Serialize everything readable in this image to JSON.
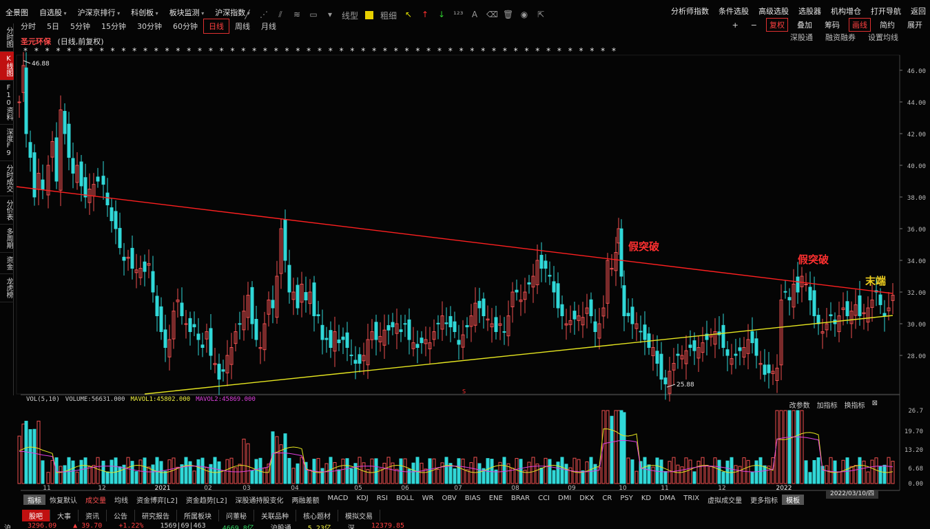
{
  "menu": [
    {
      "label": "全景图",
      "caret": false
    },
    {
      "label": "自选股",
      "caret": true
    },
    {
      "label": "沪深京排行",
      "caret": true
    },
    {
      "label": "科创板",
      "caret": true
    },
    {
      "label": "板块监测",
      "caret": true
    },
    {
      "label": "沪深指数",
      "caret": true
    }
  ],
  "periods": [
    {
      "label": "分时",
      "active": false
    },
    {
      "label": "5日",
      "active": false
    },
    {
      "label": "5分钟",
      "active": false
    },
    {
      "label": "15分钟",
      "active": false
    },
    {
      "label": "30分钟",
      "active": false
    },
    {
      "label": "60分钟",
      "active": false
    },
    {
      "label": "日线",
      "active": true
    },
    {
      "label": "周线",
      "active": false
    },
    {
      "label": "月线",
      "active": false
    }
  ],
  "drawtools": {
    "line_label": "线型",
    "width_label": "粗细"
  },
  "right_top": [
    "分析师指数",
    "条件选股",
    "高级选股",
    "选股器",
    "机构增仓",
    "打开导航",
    "返回"
  ],
  "right_row2": [
    {
      "label": "+",
      "red": false
    },
    {
      "label": "−",
      "red": false
    },
    {
      "label": "复权",
      "red": true
    },
    {
      "label": "叠加",
      "red": false
    },
    {
      "label": "筹码",
      "red": false
    },
    {
      "label": "画线",
      "red": true
    },
    {
      "label": "简约",
      "red": false
    },
    {
      "label": "展开",
      "red": false
    }
  ],
  "right_row3": [
    "深股通",
    "融资融券",
    "设置均线"
  ],
  "left_tabs": [
    {
      "label": "分时图",
      "active": false
    },
    {
      "label": "K线图",
      "active": true
    },
    {
      "label": "F10资料",
      "active": false
    },
    {
      "label": "深度F9",
      "active": false
    },
    {
      "label": "分时成交",
      "active": false
    },
    {
      "label": "分价表",
      "active": false
    },
    {
      "label": "多周期",
      "active": false
    },
    {
      "label": "资金",
      "active": false
    },
    {
      "label": "龙虎榜",
      "active": false
    }
  ],
  "stock": {
    "name": "圣元环保",
    "desc": "(日线,前复权)"
  },
  "star_row": "* * * * * * * * *  * *  * * * *  *  * *  *  * * *  *  * *  *  * * * *  * * * *  *  * *  *  *  * * *  *  * *  * * * *  * * *  * * *",
  "annotations": {
    "high": "46.88",
    "low": "25.88",
    "false_break_1": "假突破",
    "false_break_2": "假突破",
    "end": "末端",
    "marker_s": "S"
  },
  "price_axis": [
    "46.00",
    "44.00",
    "42.00",
    "40.00",
    "38.00",
    "36.00",
    "34.00",
    "32.00",
    "30.00",
    "28.00"
  ],
  "month_labels": [
    "11",
    "12",
    "2021",
    "02",
    "03",
    "04",
    "05",
    "06",
    "07",
    "08",
    "09",
    "10",
    "11",
    "12",
    "2022"
  ],
  "volume_axis": [
    "26.7",
    "19.70",
    "13.20",
    "6.68",
    "0.00"
  ],
  "indicator": {
    "name": "VOL(5,10)",
    "volume": "VOLUME:56631.000",
    "mavol1": "MAVOL1:45802.000",
    "mavol2": "MAVOL2:45869.000"
  },
  "indicator_actions": [
    "改参数",
    "加指标",
    "换指标"
  ],
  "indicator_tabs": [
    {
      "label": "指标",
      "sel": true,
      "red": false
    },
    {
      "label": "恢复默认",
      "sel": false,
      "red": false
    },
    {
      "label": "成交量",
      "sel": false,
      "red": true
    },
    {
      "label": "均线",
      "sel": false,
      "red": false
    },
    {
      "label": "资金博弈[L2]",
      "sel": false,
      "red": false
    },
    {
      "label": "资金趋势[L2]",
      "sel": false,
      "red": false
    },
    {
      "label": "深股通持股变化",
      "sel": false,
      "red": false
    },
    {
      "label": "两融差额",
      "sel": false,
      "red": false
    },
    {
      "label": "MACD",
      "sel": false,
      "red": false
    },
    {
      "label": "KDJ",
      "sel": false,
      "red": false
    },
    {
      "label": "RSI",
      "sel": false,
      "red": false
    },
    {
      "label": "BOLL",
      "sel": false,
      "red": false
    },
    {
      "label": "WR",
      "sel": false,
      "red": false
    },
    {
      "label": "OBV",
      "sel": false,
      "red": false
    },
    {
      "label": "BIAS",
      "sel": false,
      "red": false
    },
    {
      "label": "ENE",
      "sel": false,
      "red": false
    },
    {
      "label": "BRAR",
      "sel": false,
      "red": false
    },
    {
      "label": "CCI",
      "sel": false,
      "red": false
    },
    {
      "label": "DMI",
      "sel": false,
      "red": false
    },
    {
      "label": "DKX",
      "sel": false,
      "red": false
    },
    {
      "label": "CR",
      "sel": false,
      "red": false
    },
    {
      "label": "PSY",
      "sel": false,
      "red": false
    },
    {
      "label": "KD",
      "sel": false,
      "red": false
    },
    {
      "label": "DMA",
      "sel": false,
      "red": false
    },
    {
      "label": "TRIX",
      "sel": false,
      "red": false
    },
    {
      "label": "虚拟成交量",
      "sel": false,
      "red": false
    },
    {
      "label": "更多指标",
      "sel": false,
      "red": false
    },
    {
      "label": "模板",
      "sel": true,
      "red": false
    }
  ],
  "date_box": "2022/03/10/四",
  "bottom_tabs": [
    {
      "label": "股吧",
      "sel": true
    },
    {
      "label": "大事",
      "sel": false
    },
    {
      "label": "资讯",
      "sel": false
    },
    {
      "label": "公告",
      "sel": false
    },
    {
      "label": "研究报告",
      "sel": false
    },
    {
      "label": "所属板块",
      "sel": false
    },
    {
      "label": "问董秘",
      "sel": false
    },
    {
      "label": "关联品种",
      "sel": false
    },
    {
      "label": "核心题材",
      "sel": false
    },
    {
      "label": "模拟交易",
      "sel": false
    }
  ],
  "ticker": [
    {
      "text": "沪",
      "cls": "w"
    },
    {
      "text": "3296.09",
      "cls": ""
    },
    {
      "text": "▲ 39.70",
      "cls": ""
    },
    {
      "text": "+1.22%",
      "cls": ""
    },
    {
      "text": "1569|69|463",
      "cls": "w"
    },
    {
      "text": "4669.8亿",
      "cls": "g"
    },
    {
      "text": "沪股通",
      "cls": "w"
    },
    {
      "text": "5.23亿",
      "cls": "y"
    },
    {
      "text": "深",
      "cls": "w"
    },
    {
      "text": "12379.85",
      "cls": ""
    }
  ],
  "colors": {
    "up": "#f05050",
    "down": "#30d8d8",
    "resistance": "#ff2020",
    "support": "#e6e620",
    "ma5": "#e6e620",
    "ma10": "#e040e0",
    "annotation_red": "#ff3030",
    "annotation_yellow": "#f0d020"
  }
}
